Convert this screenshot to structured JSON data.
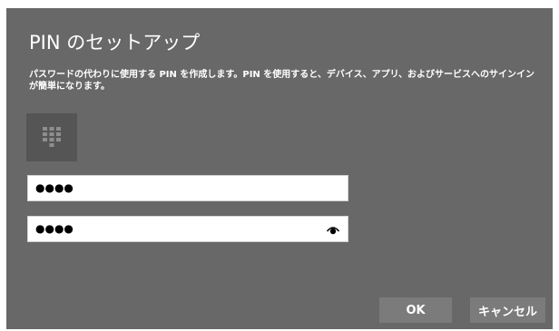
{
  "dialog": {
    "title": "PIN のセットアップ",
    "description": "パスワードの代わりに使用する PIN を作成します。PIN を使用すると、デバイス、アプリ、およびサービスへのサインインが簡単になります。",
    "keypad_icon": "keypad-icon",
    "pin_field": {
      "value": "●●●●"
    },
    "confirm_field": {
      "value": "●●●●",
      "reveal_icon": "eye-icon"
    },
    "buttons": {
      "ok_label": "OK",
      "cancel_label": "キャンセル"
    },
    "colors": {
      "background": "#686868",
      "tile": "#555555",
      "button": "#7b7b7b",
      "text": "#ffffff"
    }
  }
}
